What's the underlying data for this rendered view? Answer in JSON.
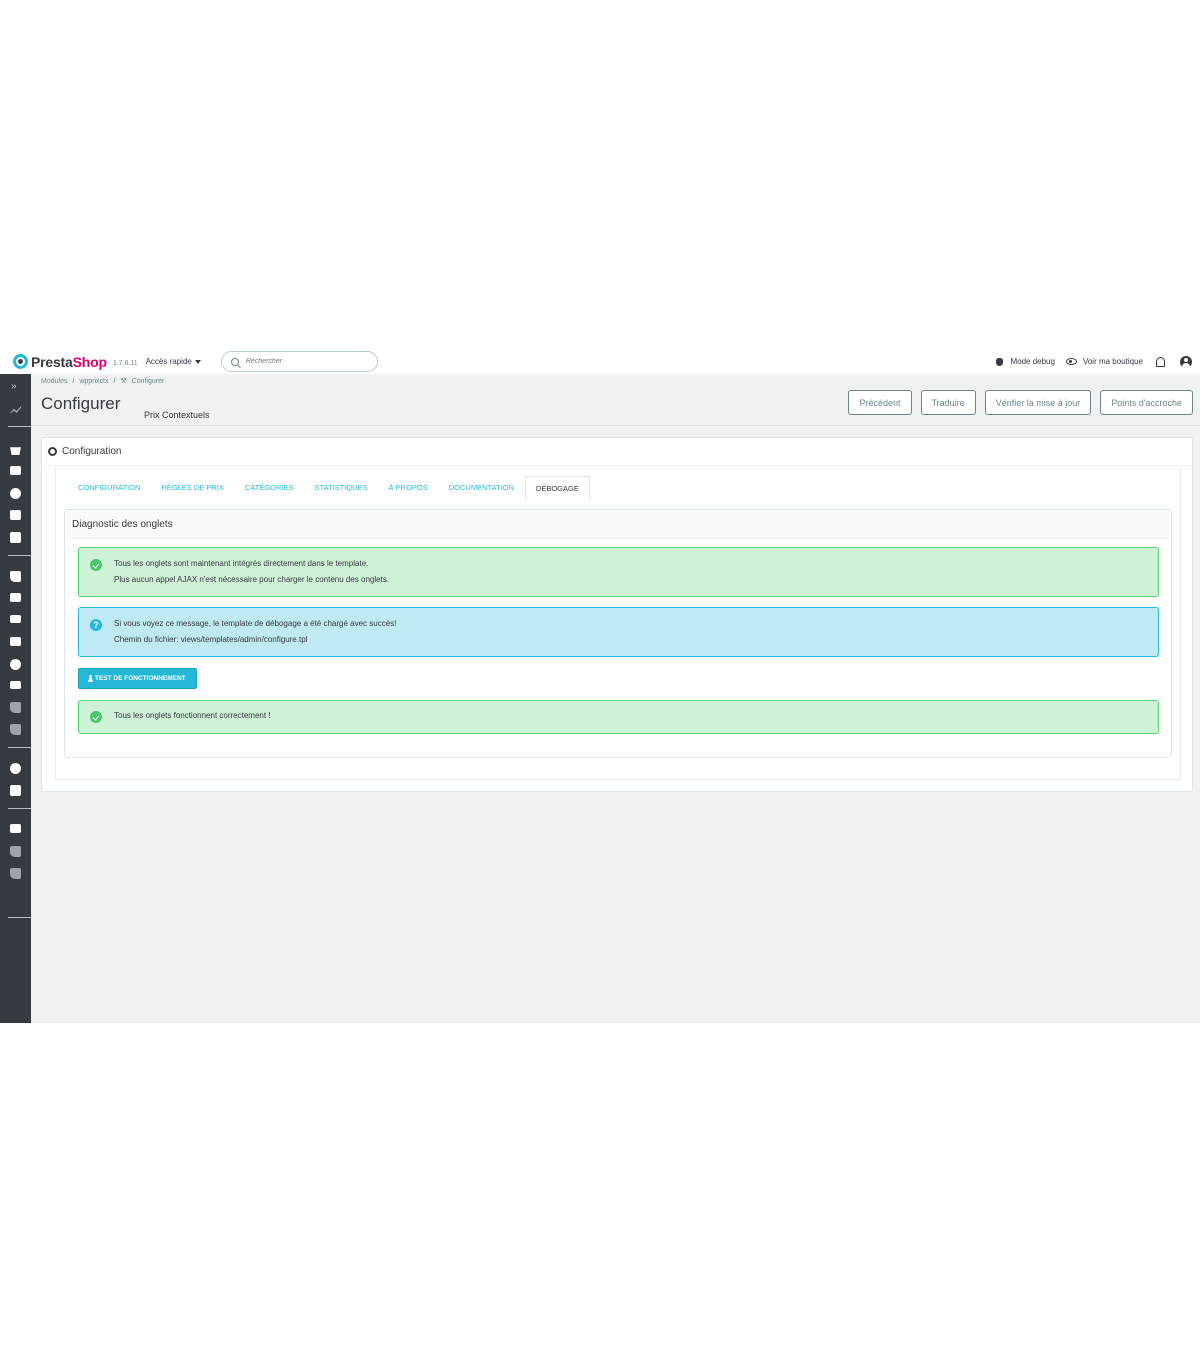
{
  "header": {
    "logo_part1": "Presta",
    "logo_part2": "Shop",
    "version": "1.7.8.11",
    "quick_access": "Accès rapide",
    "search_placeholder": "Rechercher",
    "debug_mode": "Mode debug",
    "view_shop": "Voir ma boutique"
  },
  "breadcrumb": {
    "items": [
      "Modules",
      "/",
      "wpprixctx",
      "/"
    ],
    "current": "Configurer"
  },
  "page": {
    "title": "Configurer",
    "subtitle": "Prix Contextuels"
  },
  "toolbar": {
    "prev": "Précédent",
    "translate": "Traduire",
    "check_update": "Vérifier la mise à jour",
    "hooks": "Points d'accroche"
  },
  "panel": {
    "heading": "Configuration",
    "tabs": [
      "Configuration",
      "Règles de prix",
      "Catégories",
      "Statistiques",
      "À propos",
      "Documentation",
      "Débogage"
    ],
    "active_tab": 6
  },
  "debug": {
    "heading": "Diagnostic des onglets",
    "alert_success": [
      "Tous les onglets sont maintenant intégrés directement dans le template.",
      "Plus aucun appel AJAX n'est nécessaire pour charger le contenu des onglets."
    ],
    "alert_info": [
      "Si vous voyez ce message, le template de débogage a été chargé avec succès!",
      "Chemin du fichier: views/templates/admin/configure.tpl"
    ],
    "test_button": "Test de fonctionnement",
    "result": "Tous les onglets fonctionnent correctement !"
  },
  "colors": {
    "primary": "#25b9d7",
    "brand_pink": "#df0067",
    "sidebar": "#363a41",
    "success_bg": "#cdf2d5",
    "info_bg": "#bfe9f3"
  },
  "icons": {
    "sidebar": [
      "chevrons-right-icon",
      "trending-up-icon",
      "shopping-basket-icon",
      "store-icon",
      "account-circle-icon",
      "chat-icon",
      "assessment-icon",
      "extension-icon",
      "desktop-icon",
      "local-shipping-icon",
      "credit-card-icon",
      "language-icon",
      "campaign-icon",
      "extension-icon",
      "extension-icon",
      "settings-icon",
      "settings-applications-icon",
      "tune-icon",
      "extension-icon",
      "extension-icon"
    ]
  }
}
